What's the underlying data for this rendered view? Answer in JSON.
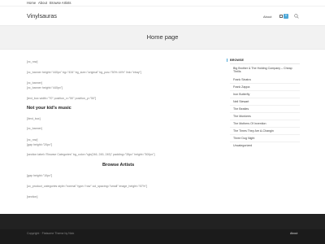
{
  "topnav": {
    "items": [
      "Home",
      "About",
      "Browse Artists"
    ]
  },
  "header": {
    "site_title": "Vinylsauras",
    "about_label": "About",
    "cart_count": "0"
  },
  "hero": {
    "title": "Home page"
  },
  "main": {
    "shortcodes": [
      "[vc_row]",
      "[vc_banner height=\"440px\" bg=\"434\" bg_size=\"original\" bg_pos=\"50% 44%\" link=\"ebay\"]",
      "[vc_banner]",
      "[vc_banner height=\"440px\"]",
      "[text_box width=\"70\" position_x=\"50\" position_y=\"50\"]",
      "[/text_box]",
      "[vc_banner]",
      "[vc_row]",
      "[gap height=\"20px\"]",
      "[section label=\"Browse Categories\" bg_color=\"rgb(246, 245, 245)\" padding=\"35px\" height=\"300px\"]",
      "[gap height=\"10px\"]",
      "[ux_product_categories style=\"normal\" type=\"row\" col_spacing=\"small\" image_height=\"67%\"]",
      "[section]"
    ],
    "section_titles": [
      "Not your kid's music",
      "Browse Artists"
    ]
  },
  "sidebar": {
    "heading": "BROWSE",
    "items": [
      "Big Brother & The Holding Company – Cheap Thrills",
      "Frank Sinatra",
      "Frank Zappa",
      "Iron Butterfly",
      "Neil Stewart",
      "The Beatles",
      "The Monkees",
      "The Mothers Of Invention",
      "The Times They Are A-Changin",
      "Three Dog Night",
      "Uncategorized"
    ]
  },
  "footer": {
    "copyright": "Copyright · Flatsome Theme by Nick",
    "about_label": "About"
  },
  "colors": {
    "accent": "#4ea8d8",
    "footer_bg": "#222222",
    "hero_bg": "#f2f2f2"
  }
}
